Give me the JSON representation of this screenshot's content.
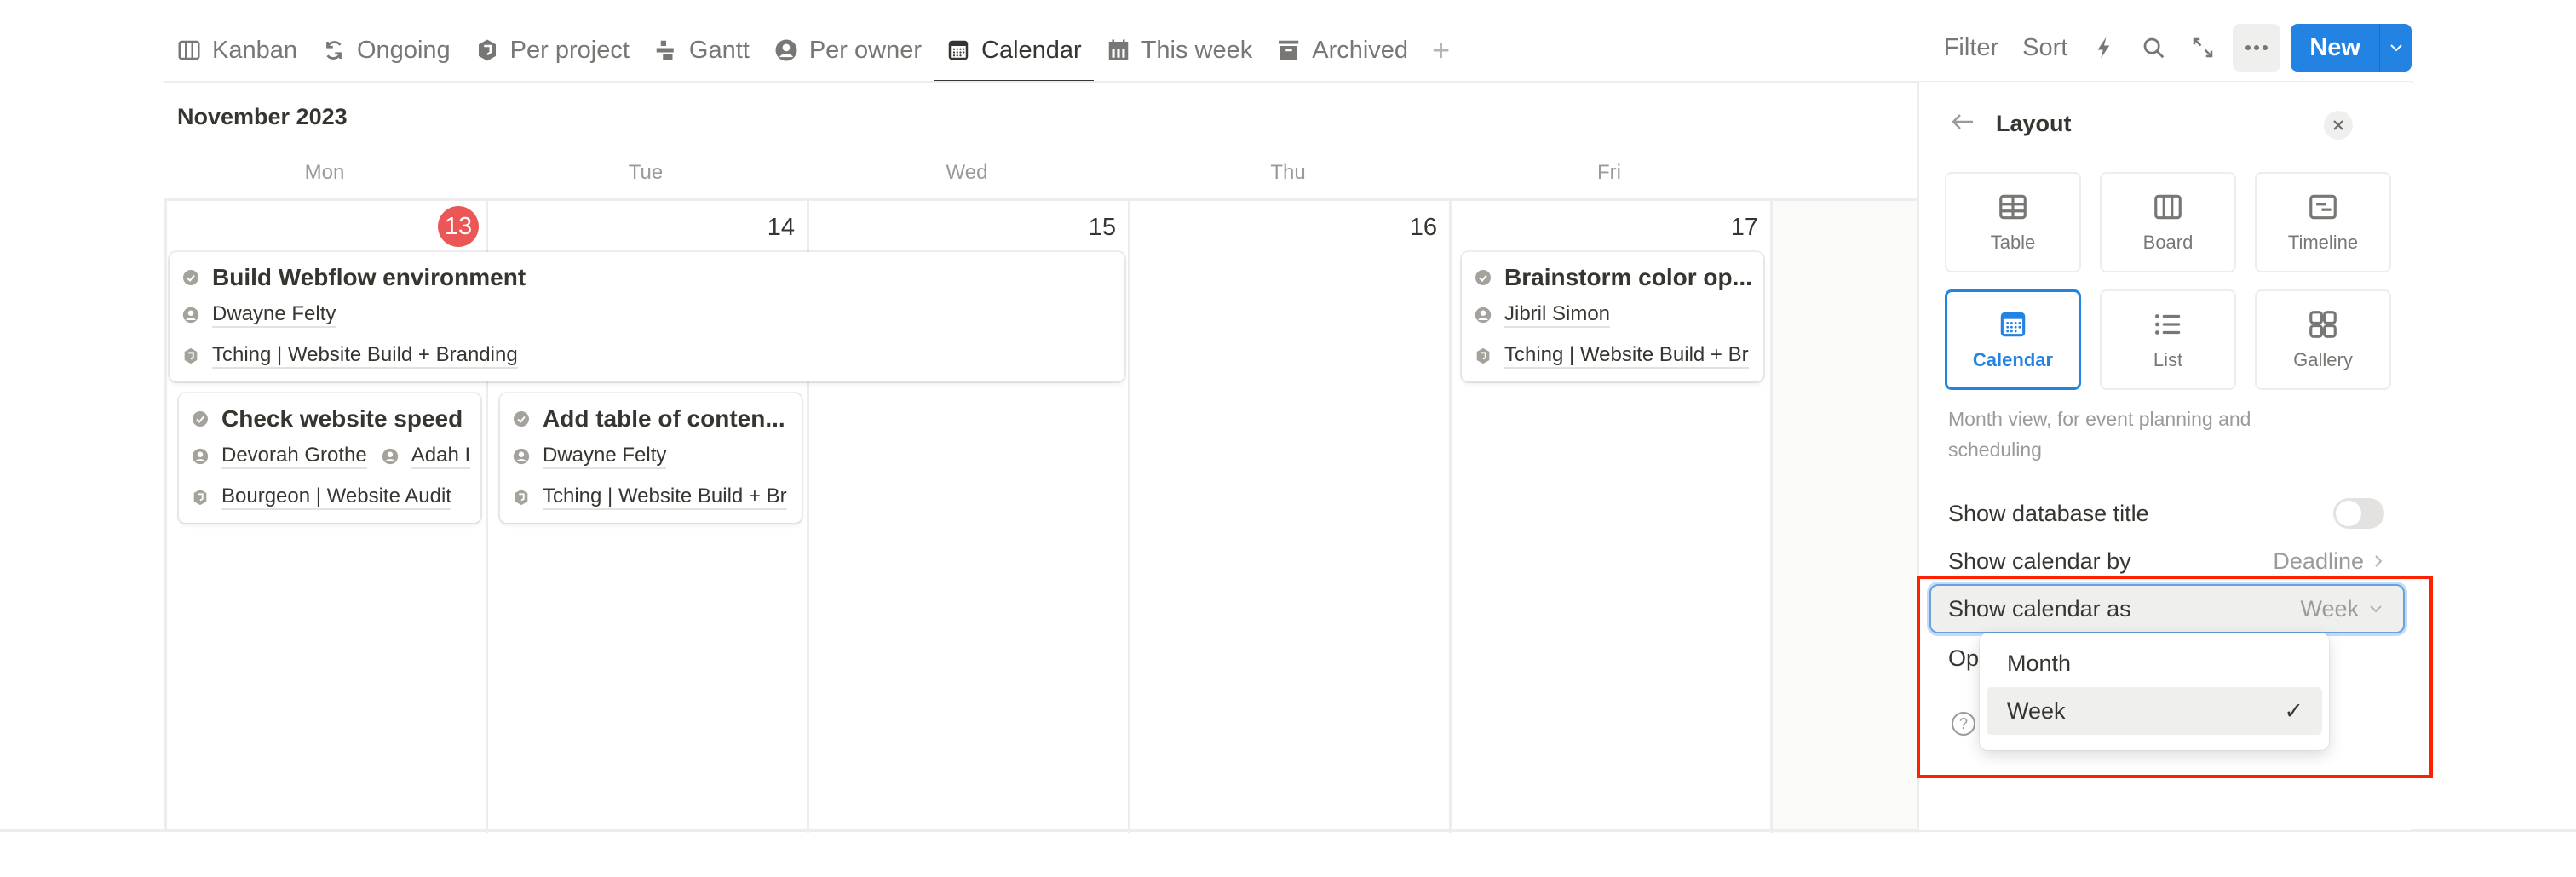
{
  "tabs": [
    {
      "label": "Kanban",
      "icon": "board-icon",
      "active": false
    },
    {
      "label": "Ongoing",
      "icon": "refresh-icon",
      "active": false
    },
    {
      "label": "Per project",
      "icon": "project-icon",
      "active": false
    },
    {
      "label": "Gantt",
      "icon": "timeline-icon",
      "active": false
    },
    {
      "label": "Per owner",
      "icon": "person-icon",
      "active": false
    },
    {
      "label": "Calendar",
      "icon": "calendar-icon",
      "active": true
    },
    {
      "label": "This week",
      "icon": "calendar-week-icon",
      "active": false
    },
    {
      "label": "Archived",
      "icon": "archive-icon",
      "active": false
    }
  ],
  "add_tab": "+",
  "toolbar": {
    "filter": "Filter",
    "sort": "Sort",
    "new": "New",
    "icons": [
      "lightning-icon",
      "search-icon",
      "expand-icon",
      "more-icon"
    ]
  },
  "calendar": {
    "month_title": "November 2023",
    "weekdays": [
      "Mon",
      "Tue",
      "Wed",
      "Thu",
      "Fri"
    ],
    "days": [
      "13",
      "14",
      "15",
      "16",
      "17"
    ],
    "today": "13",
    "today_color": "#eb5757",
    "events": [
      {
        "title": "Build Webflow environment",
        "people": [
          "Dwayne Felty"
        ],
        "project": "Tching | Website Build + Branding"
      },
      {
        "title": "Check website speed",
        "people": [
          "Devorah Grothe",
          "Adah I"
        ],
        "project": "Bourgeon | Website Audit"
      },
      {
        "title": "Add table of conten...",
        "people": [
          "Dwayne Felty"
        ],
        "project": "Tching | Website Build + Br"
      },
      {
        "title": "Brainstorm color op...",
        "people": [
          "Jibril Simon"
        ],
        "project": "Tching | Website Build + Br"
      }
    ]
  },
  "panel": {
    "title": "Layout",
    "layouts": [
      {
        "label": "Table",
        "icon": "table-icon",
        "selected": false
      },
      {
        "label": "Board",
        "icon": "board-icon",
        "selected": false
      },
      {
        "label": "Timeline",
        "icon": "timeline-icon",
        "selected": false
      },
      {
        "label": "Calendar",
        "icon": "calendar-icon",
        "selected": true
      },
      {
        "label": "List",
        "icon": "list-icon",
        "selected": false
      },
      {
        "label": "Gallery",
        "icon": "gallery-icon",
        "selected": false
      }
    ],
    "description": "Month view, for event planning and scheduling",
    "show_db_title": {
      "label": "Show database title",
      "on": false
    },
    "show_by": {
      "label": "Show calendar by",
      "value": "Deadline"
    },
    "show_as": {
      "label": "Show calendar as",
      "value": "Week"
    },
    "open_label": "Op",
    "help": "?"
  },
  "dropdown": {
    "options": [
      {
        "label": "Month",
        "selected": false
      },
      {
        "label": "Week",
        "selected": true
      }
    ],
    "check": "✓"
  },
  "colors": {
    "accent": "#2383e2",
    "today": "#eb5757",
    "annotation": "#ff2000"
  }
}
